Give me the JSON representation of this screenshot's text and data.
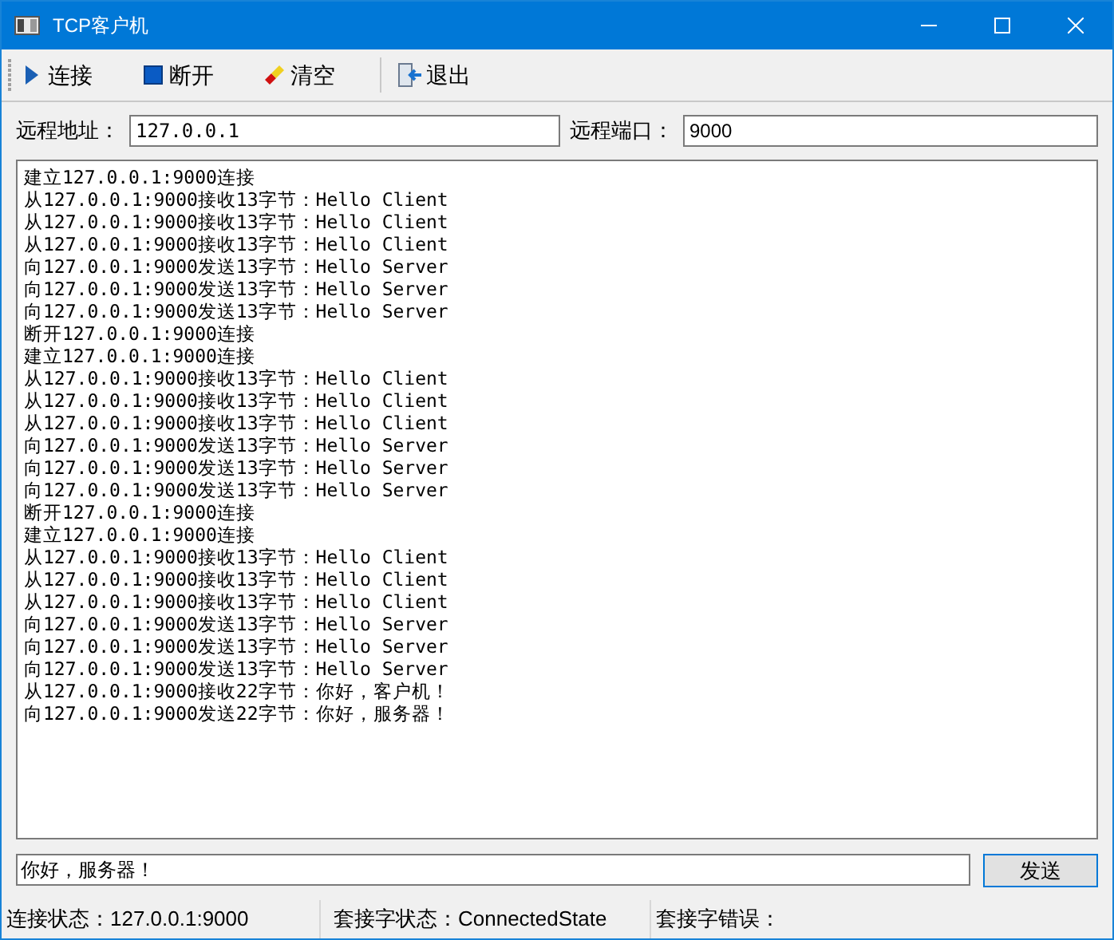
{
  "window": {
    "title": "TCP客户机"
  },
  "toolbar": [
    {
      "kind": "play",
      "label": "连接"
    },
    {
      "kind": "stop",
      "label": "断开"
    },
    {
      "kind": "eraser",
      "label": "清空"
    },
    {
      "kind": "exit",
      "label": "退出"
    }
  ],
  "address": {
    "label": "远程地址：",
    "value": "127.0.0.1"
  },
  "port": {
    "label": "远程端口：",
    "value": "9000"
  },
  "log": [
    "建立127.0.0.1:9000连接",
    "从127.0.0.1:9000接收13字节：Hello Client",
    "从127.0.0.1:9000接收13字节：Hello Client",
    "从127.0.0.1:9000接收13字节：Hello Client",
    "向127.0.0.1:9000发送13字节：Hello Server",
    "向127.0.0.1:9000发送13字节：Hello Server",
    "向127.0.0.1:9000发送13字节：Hello Server",
    "断开127.0.0.1:9000连接",
    "建立127.0.0.1:9000连接",
    "从127.0.0.1:9000接收13字节：Hello Client",
    "从127.0.0.1:9000接收13字节：Hello Client",
    "从127.0.0.1:9000接收13字节：Hello Client",
    "向127.0.0.1:9000发送13字节：Hello Server",
    "向127.0.0.1:9000发送13字节：Hello Server",
    "向127.0.0.1:9000发送13字节：Hello Server",
    "断开127.0.0.1:9000连接",
    "建立127.0.0.1:9000连接",
    "从127.0.0.1:9000接收13字节：Hello Client",
    "从127.0.0.1:9000接收13字节：Hello Client",
    "从127.0.0.1:9000接收13字节：Hello Client",
    "向127.0.0.1:9000发送13字节：Hello Server",
    "向127.0.0.1:9000发送13字节：Hello Server",
    "向127.0.0.1:9000发送13字节：Hello Server",
    "从127.0.0.1:9000接收22字节：你好，客户机！",
    "向127.0.0.1:9000发送22字节：你好，服务器！"
  ],
  "message": {
    "value": "你好，服务器！"
  },
  "send_button": "发送",
  "status_bar": [
    "连接状态：127.0.0.1:9000",
    "套接字状态：ConnectedState",
    "套接字错误："
  ]
}
